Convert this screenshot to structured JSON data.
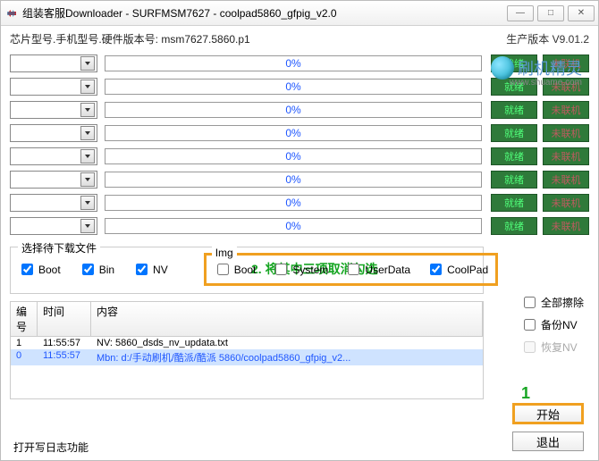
{
  "window": {
    "title": "组装客服Downloader - SURFMSM7627 - coolpad5860_gfpig_v2.0",
    "min": "—",
    "max": "□",
    "close": "✕"
  },
  "info": {
    "left": "芯片型号.手机型号.硬件版本号: msm7627.5860.p1",
    "right": "生产版本  V9.01.2"
  },
  "brand": {
    "text": "刷机精灵",
    "sub": "www.shuame.com"
  },
  "rows": [
    {
      "pct": "0%",
      "status1": "就绪",
      "status2": "未联机"
    },
    {
      "pct": "0%",
      "status1": "就绪",
      "status2": "未联机"
    },
    {
      "pct": "0%",
      "status1": "就绪",
      "status2": "未联机"
    },
    {
      "pct": "0%",
      "status1": "就绪",
      "status2": "未联机"
    },
    {
      "pct": "0%",
      "status1": "就绪",
      "status2": "未联机"
    },
    {
      "pct": "0%",
      "status1": "就绪",
      "status2": "未联机"
    },
    {
      "pct": "0%",
      "status1": "就绪",
      "status2": "未联机"
    },
    {
      "pct": "0%",
      "status1": "就绪",
      "status2": "未联机"
    }
  ],
  "annot": {
    "step2": "2. 将其中三项取消勾选",
    "step1": "1"
  },
  "files": {
    "group": "选择待下载文件",
    "boot": "Boot",
    "bin": "Bin",
    "nv": "NV",
    "img_group": "Img",
    "img_boot": "Boot",
    "img_system": "System",
    "img_userdata": "UserData",
    "img_coolpad": "CoolPad"
  },
  "opts": {
    "clear": "全部擦除",
    "backup": "备份NV",
    "restore": "恢复NV"
  },
  "log": {
    "h0": "编号",
    "h1": "时间",
    "h2": "内容",
    "rows": [
      {
        "n": "1",
        "t": "11:55:57",
        "c": "NV: 5860_dsds_nv_updata.txt"
      },
      {
        "n": "0",
        "t": "11:55:57",
        "c": "Mbn: d:/手动刷机/酷派/酷派 5860/coolpad5860_gfpig_v2..."
      }
    ]
  },
  "buttons": {
    "start": "开始",
    "exit": "退出"
  },
  "footer": "打开写日志功能"
}
